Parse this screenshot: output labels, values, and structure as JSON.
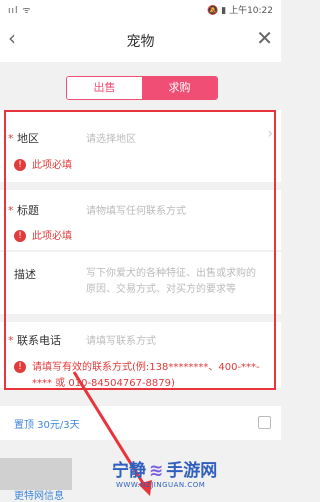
{
  "status": {
    "time": "上午10:22",
    "left_icons": "ııl ᯤ",
    "right_icons": "🔕 ▮"
  },
  "nav": {
    "title": "宠物"
  },
  "tabs": [
    {
      "label": "出售",
      "active": false
    },
    {
      "label": "求购",
      "active": true
    }
  ],
  "form": {
    "region": {
      "label": "地区",
      "placeholder": "请选择地区",
      "error": "此项必填"
    },
    "title": {
      "label": "标题",
      "placeholder": "请物填写任何联系方式",
      "error": "此项必填"
    },
    "desc": {
      "label": "描述",
      "placeholder_line1": "写下你爱犬的各种特征、出售或求购的",
      "placeholder_line2": "原因、交易方式、对买方的要求等"
    },
    "phone": {
      "label": "联系电话",
      "placeholder": "请填写联系方式",
      "error_line1": "请填写有效的联系方式(例:138********、400-***-",
      "error_line2": "**** 或 010-84504767-8879)"
    }
  },
  "top": {
    "label": "置顶 30元/3天"
  },
  "bottom": {
    "link": "更特网信息"
  },
  "watermark": {
    "brand": "宁静",
    "brand2": "手游网",
    "url": "WWW.NZJINGUAN.COM"
  },
  "colors": {
    "accent": "#f04e74",
    "error": "#e23b3b",
    "link": "#3f86d8",
    "highlight": "#e8353b"
  }
}
